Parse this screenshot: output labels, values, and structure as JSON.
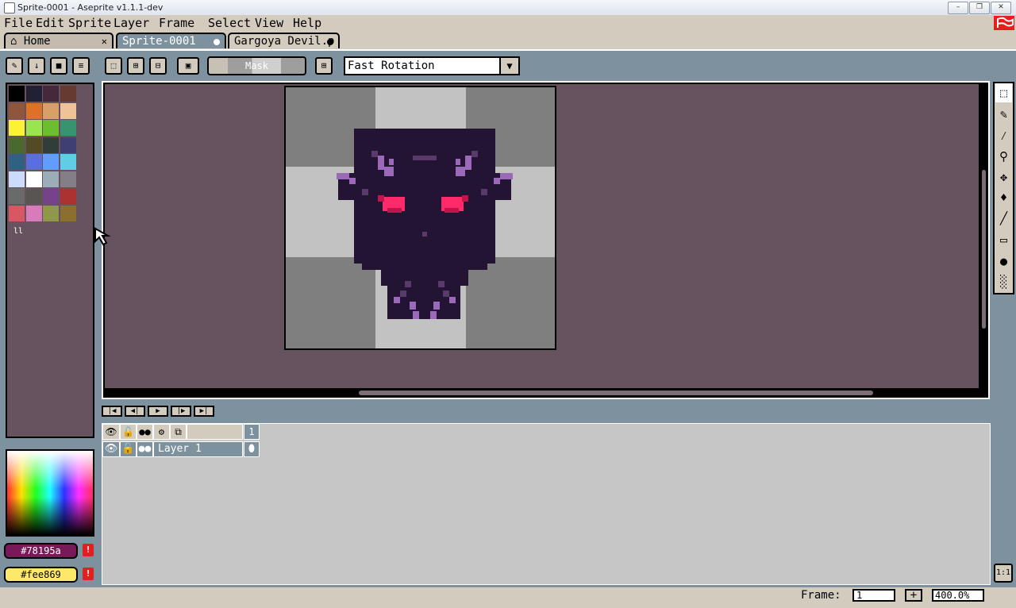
{
  "window": {
    "title": "Sprite-0001 - Aseprite v1.1.1-dev",
    "controls": [
      "–",
      "❐",
      "✕"
    ]
  },
  "menu": [
    "File",
    "Edit",
    "Sprite",
    "Layer",
    "Frame",
    "Select",
    "View",
    "Help"
  ],
  "tabs": [
    {
      "label": "Home",
      "icon": "home-icon",
      "close": "✕",
      "active": false
    },
    {
      "label": "Sprite-0001",
      "active": true
    },
    {
      "label": "Gargoya Devil.p",
      "active": false
    }
  ],
  "toolbar": {
    "mask_label": "Mask",
    "rotation": "Fast Rotation"
  },
  "palette": [
    "#000000",
    "#222034",
    "#45283c",
    "#663931",
    "#8f563b",
    "#df7126",
    "#d9a066",
    "#eec39a",
    "#fbf236",
    "#99e550",
    "#6abe30",
    "#37946e",
    "#4b692f",
    "#524b24",
    "#323c39",
    "#3f3f74",
    "#306082",
    "#5b6ee1",
    "#639bff",
    "#5fcde4",
    "#cbdbfc",
    "#ffffff",
    "#9badb7",
    "#847e87",
    "#696a6a",
    "#595652",
    "#76428a",
    "#ac3232",
    "#d95763",
    "#d77bba",
    "#8f974a",
    "#8a6f30"
  ],
  "colors": {
    "foreground": {
      "label": "#78195a",
      "hex": "#78195a"
    },
    "background": {
      "label": "#fee869",
      "hex": "#fee869"
    },
    "warning_glyph": "!",
    "canvas_bg": "#66535f",
    "ui_bg": "#7d929e",
    "ui_face": "#d3cbbe"
  },
  "timeline": {
    "frame_number": "1",
    "layer_name": "Layer 1"
  },
  "status": {
    "frame_label": "Frame:",
    "frame_value": "1",
    "plus": "+",
    "zoom": "400.0%"
  },
  "misc": {
    "one_to_one": "1:1",
    "grip": "ll"
  }
}
